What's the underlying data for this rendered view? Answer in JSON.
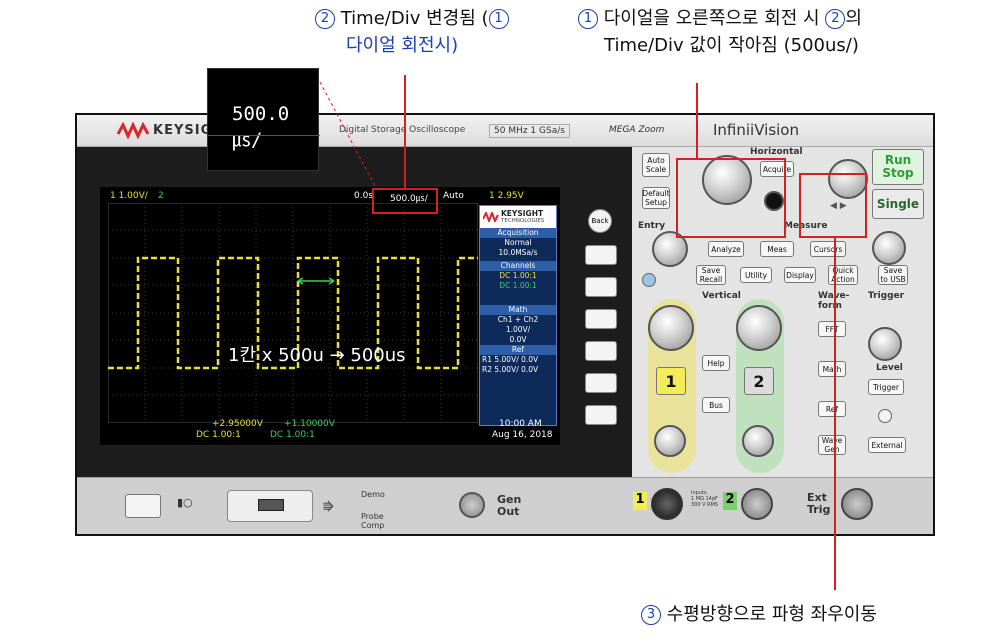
{
  "annotations": {
    "a2_line1": "Time/Div 변경됨 (",
    "a2_line2": "다이얼 회전시)",
    "a1_line1": "다이얼을 오른쪽으로 회전 시",
    "a1_suffix": "의",
    "a1_line2": "Time/Div  값이 작아짐 (500us/)",
    "a3": "수평방향으로 파형 좌우이동",
    "num1": "1",
    "num2": "2",
    "num3": "3",
    "inset_value": "500.0㎲/",
    "measure_text": "1칸 x 500u → 500us"
  },
  "device": {
    "brand": "KEYSIGHT",
    "model_desc": "Digital Storage Oscilloscope",
    "spec": "50 MHz  1 GSa/s",
    "megazoom": "MEGA Zoom",
    "series": "InfiniiVision"
  },
  "screen": {
    "ch1_scale": "1   1.00V/",
    "ch2_label": "2",
    "delay": "0.0s",
    "timebase": "500.0㎲/",
    "trig_mode": "Auto",
    "trig_info": "1   2.95V",
    "bottom_ch1_volt": "+2.95000V",
    "bottom_ch1_cpl": "DC          1.00:1",
    "bottom_ch2_volt": "+1.10000V",
    "bottom_ch2_cpl": "DC          1.00:1",
    "time": "10:00 AM",
    "date": "Aug 16, 2018",
    "sidepanel": {
      "logo": "KEYSIGHT",
      "logo_sub": "TECHNOLOGIES",
      "acq_header": "Acquisition",
      "acq_mode": "Normal",
      "acq_rate": "10.0MSa/s",
      "channels_header": "Channels",
      "ch1_row": "DC          1.00:1",
      "ch2_row": "DC          1.00:1",
      "math_header": "Math",
      "math_expr": "Ch1 + Ch2",
      "math_scale": "1.00V/",
      "math_offset": "0.0V",
      "ref_header": "Ref",
      "r1": "R1  5.00V/       0.0V",
      "r2": "R2  5.00V/       0.0V"
    }
  },
  "panel": {
    "horizontal": "Horizontal",
    "run_stop": "Run\nStop",
    "single": "Single",
    "auto_scale": "Auto\nScale",
    "default_setup": "Default\nSetup",
    "acquire": "Acquire",
    "push_fine": "Push\nFine",
    "push_nav": "Push\nto",
    "entry": "Entry",
    "measure": "Measure",
    "analyze": "Analyze",
    "meas": "Meas",
    "cursors": "Cursors",
    "push_select": "Push to\nSelect",
    "push_select2": "Push to Select",
    "intensity": "Intensity",
    "save_recall": "Save\nRecall",
    "utility": "Utility",
    "display": "Display",
    "quick_action": "Quick\nAction",
    "save_usb": "Save\nto USB",
    "vertical": "Vertical",
    "waveform": "Wave-\nform",
    "trigger": "Trigger",
    "push_50": "Push for 50%",
    "fft": "FFT",
    "math": "Math",
    "ref": "Ref",
    "wave_gen": "Wave\nGen",
    "level": "Level",
    "trigger_btn": "Trigger",
    "force": "Force",
    "external": "External",
    "help": "Help",
    "bus": "Bus",
    "ch1": "1",
    "ch2": "2",
    "push_for_fine": "Push\nfor Fine",
    "push_to_zero": "Push\nto Zero",
    "back": "Back"
  },
  "bottom": {
    "demo": "Demo",
    "probe_comp": "Probe\nComp",
    "gen_out": "Gen\nOut",
    "ext_trig": "Ext\nTrig",
    "ch1": "1",
    "ch2": "2",
    "inputs": "Inputs\n1 MΩ 14pF\n300 V RMS"
  },
  "colors": {
    "trace_ch1": "#e7e03a",
    "trace_ch2": "#38d05b",
    "annotation_red": "#d42020",
    "circle_blue": "#1a3fae",
    "brand_red": "#d9262b"
  }
}
